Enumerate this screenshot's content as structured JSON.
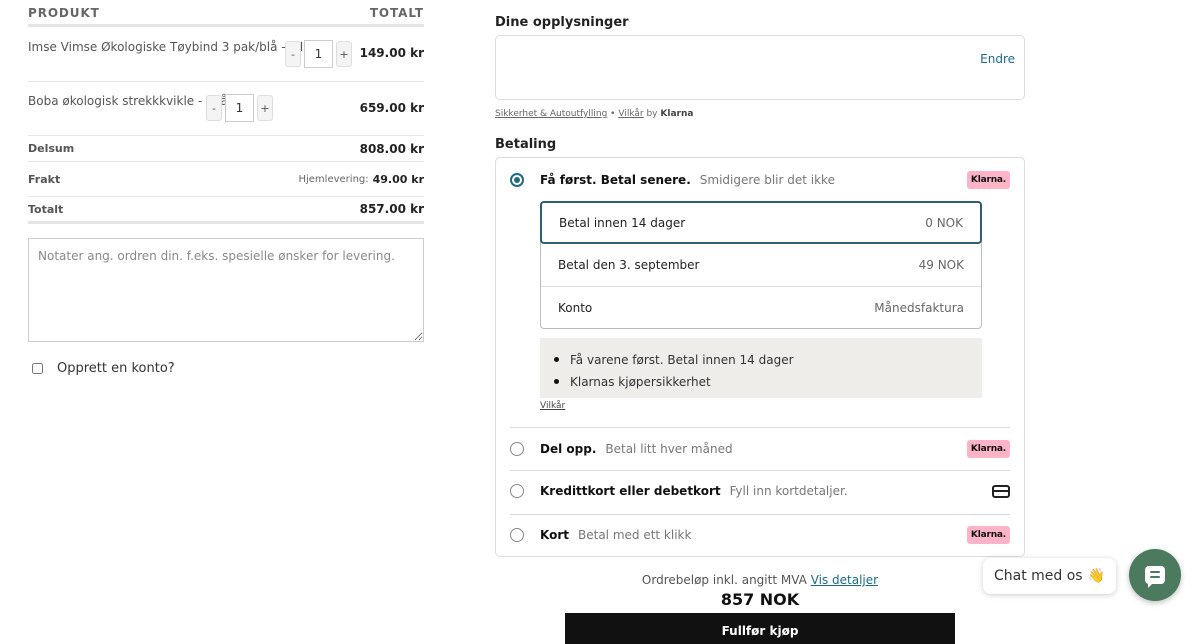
{
  "order": {
    "col_product": "PRODUKT",
    "col_total": "TOTALT",
    "items": [
      {
        "name": "Imse Vimse Økologiske Tøybind 3 pak/blå - MINI",
        "qty": "1",
        "price": "149.00 kr",
        "minus": "-",
        "plus": "+"
      },
      {
        "name": "Boba økologisk strekkkvikle - Grå",
        "qty": "1",
        "price": "659.00 kr",
        "minus": "-",
        "plus": "+"
      }
    ],
    "subtotal_label": "Delsum",
    "subtotal": "808.00 kr",
    "shipping_label": "Frakt",
    "shipping_method": "Hjemlevering:",
    "shipping": "49.00 kr",
    "total_label": "Totalt",
    "total": "857.00 kr",
    "notes_placeholder": "Notater ang. ordren din. f.eks. spesielle ønsker for levering.",
    "create_account_label": "Opprett en konto?"
  },
  "klarna": {
    "details_heading": "Dine opplysninger",
    "edit_link": "Endre",
    "legal_link1": "Sikkerhet & Autoutfylling",
    "legal_sep": "•",
    "legal_link2": "Vilkår",
    "legal_by": "by",
    "legal_brand": "Klarna",
    "payment_heading": "Betaling",
    "options": [
      {
        "title": "Få først. Betal senere.",
        "subtitle": "Smidigere blir det ikke",
        "badge": "Klarna.",
        "selected": true
      },
      {
        "title": "Del opp.",
        "subtitle": "Betal litt hver måned",
        "badge": "Klarna.",
        "selected": false
      },
      {
        "title": "Kredittkort eller debetkort",
        "subtitle": "Fyll inn kortdetaljer.",
        "icon": "credit-card-icon",
        "selected": false
      },
      {
        "title": "Kort",
        "subtitle": "Betal med ett klikk",
        "badge": "Klarna.",
        "selected": false
      }
    ],
    "plans": [
      {
        "label": "Betal innen 14 dager",
        "amount": "0 NOK"
      },
      {
        "label": "Betal den 3. september",
        "amount": "49 NOK"
      },
      {
        "label": "Konto",
        "amount": "Månedsfaktura"
      }
    ],
    "bullets": [
      "Få varene først. Betal innen 14 dager",
      "Klarnas kjøpersikkerhet"
    ],
    "terms_link": "Vilkår",
    "summary_text": "Ordrebeløp inkl. angitt MVA",
    "summary_link": "Vis detaljer",
    "summary_amount": "857 NOK",
    "buy_button": "Fullfør kjøp"
  },
  "chat": {
    "bubble_text": "Chat med os",
    "emoji": "👋"
  },
  "colors": {
    "accent": "#1d6a85",
    "klarna_pink": "#ffb3c7",
    "chat_green": "#4c7a5e",
    "buy_black": "#111111"
  }
}
